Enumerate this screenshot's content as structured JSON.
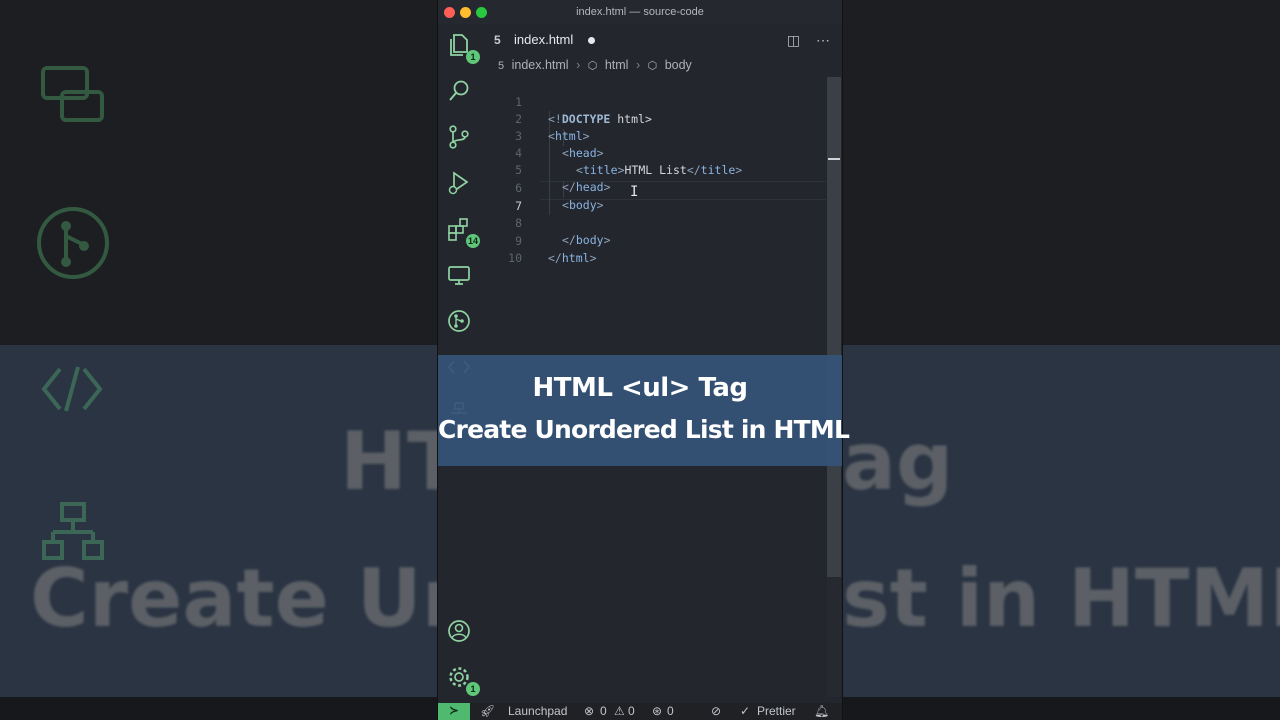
{
  "window": {
    "title": "index.html — source-code"
  },
  "tab": {
    "filename": "index.html",
    "icon": "html5-icon"
  },
  "breadcrumb": {
    "file": "index.html",
    "element1": "html",
    "element2": "body"
  },
  "activity": {
    "explorer_badge": "1",
    "extensions_badge": "14",
    "settings_badge": "1"
  },
  "editor": {
    "line_numbers": [
      "1",
      "2",
      "3",
      "4",
      "5",
      "6",
      "7",
      "8",
      "9",
      "10"
    ],
    "active_line": "7",
    "lines": {
      "l1_a": "<!",
      "l1_b": "DOCTYPE",
      "l1_c": " html>",
      "l2_open": "<",
      "l2_tag": "html",
      "l2_close": ">",
      "l3_open": "<",
      "l3_tag": "head",
      "l3_close": ">",
      "l4_open": "<",
      "l4_tag": "title",
      "l4_mid": ">",
      "l4_text": "HTML List",
      "l4_end_open": "</",
      "l4_end_tag": "title",
      "l4_end_close": ">",
      "l5_open": "</",
      "l5_tag": "head",
      "l5_close": ">",
      "l6_open": "<",
      "l6_tag": "body",
      "l6_close": ">",
      "l8_open": "</",
      "l8_tag": "body",
      "l8_close": ">",
      "l9_open": "</",
      "l9_tag": "html",
      "l9_close": ">"
    }
  },
  "banner": {
    "line1": "HTML <ul> Tag",
    "line2": "Create Unordered List in HTML"
  },
  "background_text": {
    "line1": "HT",
    "line1b": "ag",
    "line2": "Create Un",
    "line2b": "st in HTML"
  },
  "statusbar": {
    "launchpad": "Launchpad",
    "errors": "0",
    "warnings": "0",
    "ports": "0",
    "prettier": "Prettier"
  },
  "colors": {
    "accent": "#5fc77a",
    "banner": "#355278",
    "editor_bg": "#23262c"
  }
}
